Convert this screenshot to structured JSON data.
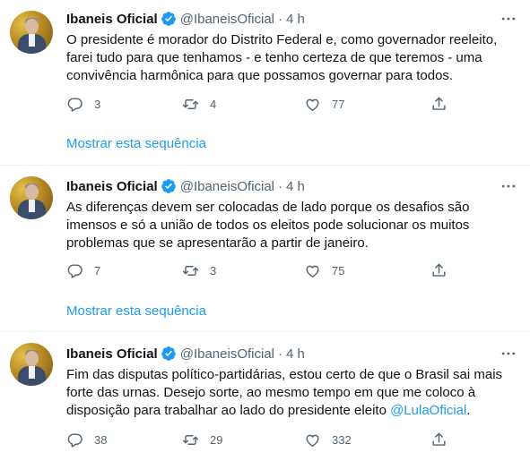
{
  "tweets": [
    {
      "name": "Ibaneis Oficial",
      "handle": "@IbaneisOficial",
      "separator": "·",
      "time": "4 h",
      "text_lines": [
        "O presidente é morador do Distrito Federal e, como governador reeleito,",
        "farei tudo para que tenhamos - e tenho certeza de que teremos - uma",
        "convivência harmônica para que possamos governar para todos."
      ],
      "mention": "",
      "replies": "3",
      "retweets": "4",
      "likes": "77",
      "show_thread": "Mostrar esta sequência"
    },
    {
      "name": "Ibaneis Oficial",
      "handle": "@IbaneisOficial",
      "separator": "·",
      "time": "4 h",
      "text_lines": [
        "As diferenças devem ser colocadas de lado porque os desafios são",
        "imensos e só a união de todos os eleitos pode solucionar os muitos",
        "problemas que se apresentarão a partir de janeiro."
      ],
      "mention": "",
      "replies": "7",
      "retweets": "3",
      "likes": "75",
      "show_thread": "Mostrar esta sequência"
    },
    {
      "name": "Ibaneis Oficial",
      "handle": "@IbaneisOficial",
      "separator": "·",
      "time": "4 h",
      "text_lines": [
        "Fim das disputas político-partidárias, estou certo de que o Brasil sai mais",
        "forte das urnas. Desejo sorte, ao mesmo tempo em que me coloco à",
        "disposição para trabalhar ao lado do presidente eleito "
      ],
      "mention": "@LulaOficial",
      "mention_suffix": ".",
      "replies": "38",
      "retweets": "29",
      "likes": "332",
      "show_thread": ""
    }
  ],
  "icons": {
    "verified": "verified-badge-icon",
    "more": "more-horizontal-icon",
    "reply": "reply-icon",
    "retweet": "retweet-icon",
    "like": "heart-icon",
    "share": "share-icon"
  },
  "colors": {
    "accent": "#1d9bf0",
    "text": "#0f1419",
    "secondary": "#536471",
    "divider": "#eff3f4"
  }
}
